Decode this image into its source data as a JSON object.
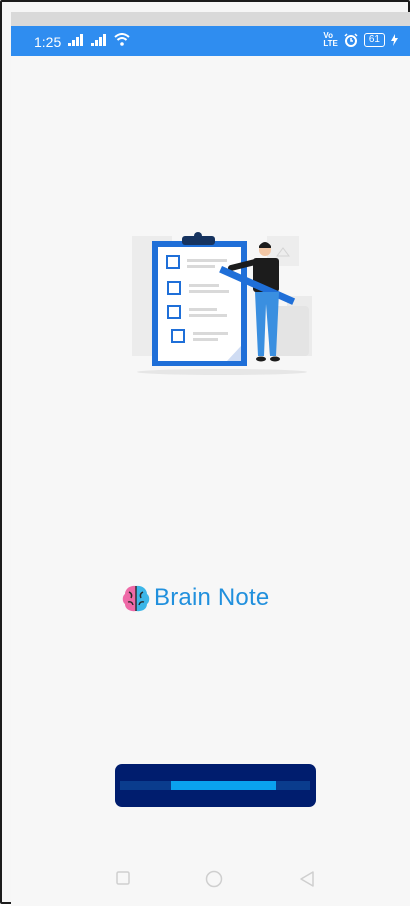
{
  "status_bar": {
    "time": "1:25",
    "battery": "61",
    "icons": [
      "signal-icon",
      "signal-icon",
      "wifi-icon",
      "volte-icon",
      "alarm-icon",
      "battery-icon",
      "charging-icon"
    ]
  },
  "brand": {
    "name": "Brain Note",
    "logo_icon": "brain-icon"
  },
  "loading": {
    "progress": 0.55
  },
  "nav": {
    "icons": [
      "recents-square-icon",
      "home-circle-icon",
      "back-triangle-icon"
    ]
  },
  "colors": {
    "status_bar": "#2f8df0",
    "brand_text": "#2190dd",
    "loader_bg": "#001d6e",
    "loader_fill": "#0aa2ee"
  }
}
